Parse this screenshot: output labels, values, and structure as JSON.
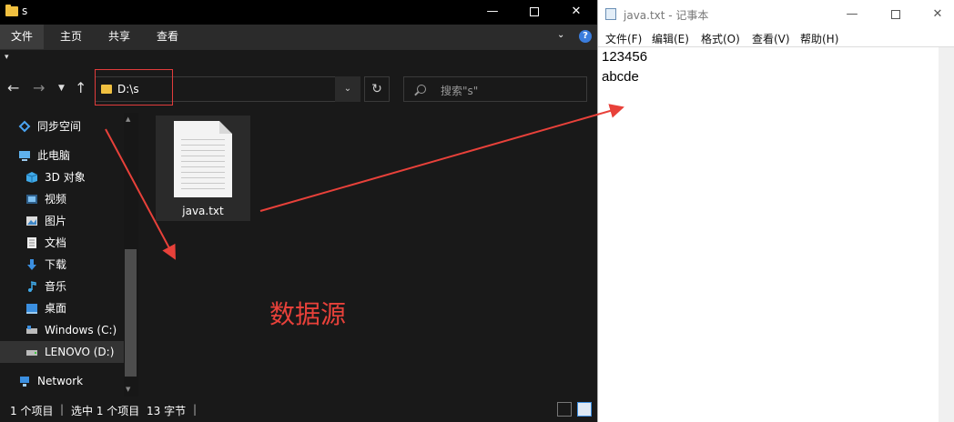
{
  "explorer": {
    "window_title": "s",
    "window_controls": {
      "minimize": "—",
      "close": "✕"
    },
    "ribbon": {
      "file": "文件",
      "home": "主页",
      "share": "共享",
      "view": "查看",
      "help": "?"
    },
    "address": {
      "path": "D:\\s"
    },
    "search": {
      "placeholder": "搜索\"s\""
    },
    "nav_items": [
      {
        "label": "同步空间",
        "icon": "cloud-sync-icon"
      },
      {
        "label": "此电脑",
        "icon": "computer-icon"
      },
      {
        "label": "3D 对象",
        "icon": "cube-icon"
      },
      {
        "label": "视频",
        "icon": "video-icon"
      },
      {
        "label": "图片",
        "icon": "image-icon"
      },
      {
        "label": "文档",
        "icon": "document-icon"
      },
      {
        "label": "下载",
        "icon": "download-icon"
      },
      {
        "label": "音乐",
        "icon": "music-icon"
      },
      {
        "label": "桌面",
        "icon": "desktop-icon"
      },
      {
        "label": "Windows (C:)",
        "icon": "drive-icon"
      },
      {
        "label": "LENOVO (D:)",
        "icon": "drive-icon"
      },
      {
        "label": "Network",
        "icon": "network-icon"
      }
    ],
    "files": [
      {
        "name": "java.txt",
        "icon": "text-file-icon"
      }
    ],
    "annotation": "数据源",
    "status": {
      "items": "1 个项目",
      "selected": "选中 1 个项目",
      "size": "13 字节"
    },
    "colors": {
      "annotation_red": "#e8413a",
      "background": "#191919"
    }
  },
  "notepad": {
    "window_title": "java.txt - 记事本",
    "window_controls": {
      "minimize": "—",
      "close": "✕"
    },
    "menus": [
      "文件(F)",
      "编辑(E)",
      "格式(O)",
      "查看(V)",
      "帮助(H)"
    ],
    "lines": [
      "123456",
      "abcde"
    ]
  }
}
